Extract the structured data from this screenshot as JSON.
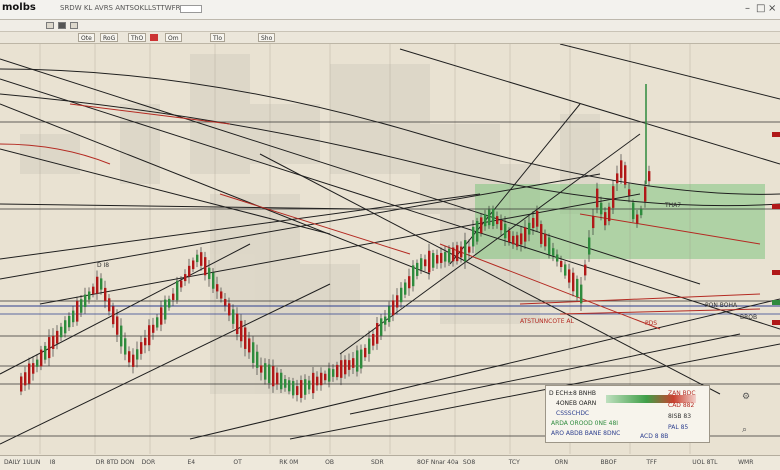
{
  "window": {
    "title": "molbs",
    "menu_text": "SRDW KL AVRS ANTSOKLLSTTWFRLSR",
    "search_placeholder": "",
    "controls": [
      "–",
      "□",
      "×"
    ]
  },
  "toolbar": {
    "buttons": [
      "Ote",
      "RoG",
      "ThO",
      "Om",
      "Tlo",
      "Sho"
    ]
  },
  "time_axis": {
    "labels": [
      "DAILY 1ULIN",
      "I8",
      "DR 8TD DON",
      "DOR",
      "E4",
      "OT",
      "RK 0M",
      "OB",
      "SDR",
      "8OF Nnar 40a",
      "SO8",
      "TCY",
      "ORN",
      "BBOF",
      "TFF",
      "UOL 8TL",
      "WMR"
    ]
  },
  "info_panel": {
    "line1": "D ECH±8 BNHB",
    "line2": "4ONEB OARN",
    "line3": "CSSSCHDC",
    "line4": "ARDA OROOD 0NE 48I",
    "line5": "ARO ABDB BANE 8DNC"
  },
  "float_labels": {
    "label_a": "ATSTUNNCOTE AL",
    "label_b": "D I8",
    "label_c": "PON BOHA",
    "label_d": "BROB",
    "label_e": "PDS",
    "label_f": "THA7",
    "price_right_1": "ZAN BDC",
    "price_right_2": "CAD 882",
    "price_right_3": "8ISB 83",
    "price_right_4": "PAL 85",
    "price_right_5": "ACD 8 8B"
  },
  "colors": {
    "background": "#e9e2d2",
    "bull": "#2e8b3d",
    "bear": "#b01818",
    "line": "#222222",
    "red_line": "#b42a22",
    "blue_line": "#2d3f8f",
    "highlight_green": "#7fc47f"
  },
  "icons": [
    "minimize-icon",
    "maximize-icon",
    "close-icon",
    "settings-icon",
    "zoom-icon"
  ]
}
